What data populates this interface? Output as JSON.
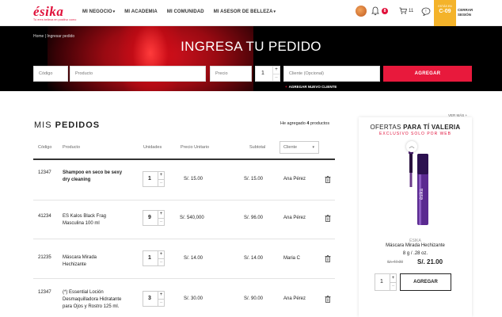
{
  "header": {
    "logo_text": "ésika",
    "logo_tagline": "Tú eres belleza en positivo como",
    "nav": [
      {
        "label": "MI NEGOCIO",
        "has_caret": true
      },
      {
        "label": "MI ACADEMIA",
        "has_caret": false
      },
      {
        "label": "MI COMUNIDAD",
        "has_caret": false
      },
      {
        "label": "MI ASESOR DE BELLEZA",
        "has_caret": true
      }
    ],
    "notifications_count": "8",
    "cart_count": "11",
    "campaign_label": "ESTÁS EN",
    "campaign_code": "C-09",
    "logout_label_1": "CERRAR",
    "logout_label_2": "SESIÓN"
  },
  "hero": {
    "breadcrumb": "Home | Ingresar pedido",
    "title": "INGRESA TU PEDIDO",
    "placeholders": {
      "code": "Código",
      "product": "Producto",
      "price": "Precio",
      "client": "Cliente (Opcional)"
    },
    "quantity": "1",
    "add_button": "AGREGAR",
    "add_new_client": "AGREGAR NUEVO CLIENTE"
  },
  "orders": {
    "title_light": "MIS",
    "title_bold": "PEDIDOS",
    "added_prefix": "He agregado",
    "added_count": "4",
    "added_suffix": "productos",
    "columns": {
      "code": "Código",
      "product": "Producto",
      "units": "Unidades",
      "unit_price": "Precio Unitario",
      "subtotal": "Subtotal",
      "client": "Cliente"
    },
    "rows": [
      {
        "code": "12347",
        "product": [
          "Shampoo en seco be sexy",
          "dry cleaning"
        ],
        "product_bold": true,
        "units": "1",
        "unit_price": "S/. 15.00",
        "subtotal": "S/. 15.00",
        "client": "Ana Pérez"
      },
      {
        "code": "41234",
        "product": [
          "ES Kalos Black Frag",
          "Masculina 100 ml"
        ],
        "product_bold": false,
        "units": "9",
        "unit_price": "S/. 540,000",
        "subtotal": "S/. 96.00",
        "client": "Ana Pérez"
      },
      {
        "code": "21235",
        "product": [
          "Máscara Mirada",
          "Hechizante"
        ],
        "product_bold": false,
        "units": "1",
        "unit_price": "S/. 14.00",
        "subtotal": "S/. 14.00",
        "client": "Maria C"
      },
      {
        "code": "12347",
        "product": [
          "(*) Essential Loción",
          "Desmaquilladora Hidratante",
          "para Ojos y Rostro 125 ml."
        ],
        "product_bold": false,
        "units": "3",
        "unit_price": "S/. 30.00",
        "subtotal": "S/. 90.00",
        "client": "Ana Pérez"
      }
    ]
  },
  "offers": {
    "see_more": "VER MÁS",
    "title_light": "OFERTAS",
    "title_bold": "PARA TÍ VALERIA",
    "subtitle": "EXCLUSIVO SOLO POR WEB",
    "product": {
      "brand": "ÉSIKA",
      "name": "Máscara Mirada Hechizante",
      "size": "8 g / .28 oz.",
      "old_price": "S/. 47.00",
      "price": "S/. 21.00",
      "quantity": "1",
      "add_button": "AGREGAR"
    }
  },
  "colors": {
    "brand_red": "#e0103a",
    "add_button": "#e8193c",
    "campaign_badge": "#f4b32a"
  }
}
